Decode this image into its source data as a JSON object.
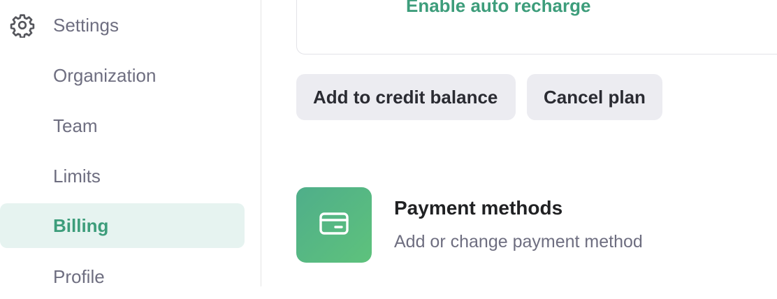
{
  "sidebar": {
    "header": {
      "icon": "gear-icon",
      "label": "Settings"
    },
    "items": [
      {
        "label": "Organization",
        "active": false
      },
      {
        "label": "Team",
        "active": false
      },
      {
        "label": "Limits",
        "active": false
      },
      {
        "label": "Billing",
        "active": true
      },
      {
        "label": "Profile",
        "active": false
      }
    ]
  },
  "main": {
    "recharge": {
      "link_label": "Enable auto recharge"
    },
    "buttons": {
      "add_credit_label": "Add to credit balance",
      "cancel_plan_label": "Cancel plan"
    },
    "payment_methods": {
      "icon": "credit-card-icon",
      "title": "Payment methods",
      "subtitle": "Add or change payment method"
    }
  },
  "colors": {
    "accent": "#3d9d7b",
    "active_bg": "#e6f3f0",
    "button_bg": "#ececf1",
    "muted_text": "#6e6e80"
  }
}
